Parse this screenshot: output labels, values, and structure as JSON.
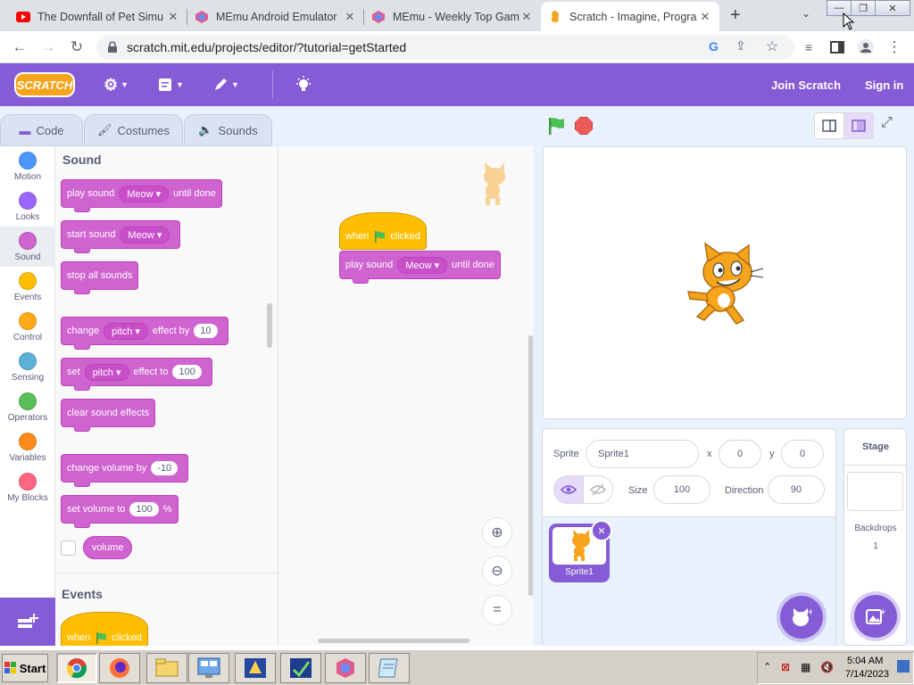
{
  "browser": {
    "tabs": [
      {
        "title": "The Downfall of Pet Simu",
        "icon": "youtube-icon",
        "active": false
      },
      {
        "title": "MEmu Android Emulator",
        "icon": "memu-icon",
        "active": false
      },
      {
        "title": "MEmu - Weekly Top Gam",
        "icon": "memu-icon",
        "active": false
      },
      {
        "title": "Scratch - Imagine, Progra",
        "icon": "scratch-icon",
        "active": true
      }
    ],
    "url": "scratch.mit.edu/projects/editor/?tutorial=getStarted"
  },
  "menu": {
    "logo": "SCRATCH",
    "join": "Join Scratch",
    "signin": "Sign in"
  },
  "editor_tabs": {
    "code": "Code",
    "costumes": "Costumes",
    "sounds": "Sounds"
  },
  "categories": [
    {
      "label": "Motion",
      "color": "#4c97ff"
    },
    {
      "label": "Looks",
      "color": "#9966ff"
    },
    {
      "label": "Sound",
      "color": "#cf63cf"
    },
    {
      "label": "Events",
      "color": "#ffbf00"
    },
    {
      "label": "Control",
      "color": "#ffab19"
    },
    {
      "label": "Sensing",
      "color": "#5cb1d6"
    },
    {
      "label": "Operators",
      "color": "#59c059"
    },
    {
      "label": "Variables",
      "color": "#ff8c1a"
    },
    {
      "label": "My Blocks",
      "color": "#ff6680"
    }
  ],
  "palette": {
    "sound_heading": "Sound",
    "events_heading": "Events",
    "b1": {
      "a": "play sound",
      "dd": "Meow",
      "b": "until done"
    },
    "b2": {
      "a": "start sound",
      "dd": "Meow"
    },
    "b3": {
      "a": "stop all sounds"
    },
    "b4": {
      "a": "change",
      "dd": "pitch",
      "b": "effect by",
      "num": "10"
    },
    "b5": {
      "a": "set",
      "dd": "pitch",
      "b": "effect to",
      "num": "100"
    },
    "b6": {
      "a": "clear sound effects"
    },
    "b7": {
      "a": "change volume by",
      "num": "-10"
    },
    "b8": {
      "a": "set volume to",
      "num": "100",
      "b": "%"
    },
    "b9": {
      "a": "volume"
    },
    "ev": {
      "a": "when",
      "b": "clicked"
    }
  },
  "script": {
    "hat": {
      "a": "when",
      "b": "clicked"
    },
    "play": {
      "a": "play sound",
      "dd": "Meow",
      "b": "until done"
    }
  },
  "zoom": {
    "reset": "="
  },
  "sprite": {
    "label": "Sprite",
    "name": "Sprite1",
    "x_label": "x",
    "x": "0",
    "y_label": "y",
    "y": "0",
    "size_label": "Size",
    "size": "100",
    "direction_label": "Direction",
    "direction": "90",
    "thumb_name": "Sprite1"
  },
  "stage_panel": {
    "title": "Stage",
    "backdrops_label": "Backdrops",
    "backdrops_count": "1"
  },
  "taskbar": {
    "start": "Start",
    "time": "5:04 AM",
    "date": "7/14/2023"
  }
}
